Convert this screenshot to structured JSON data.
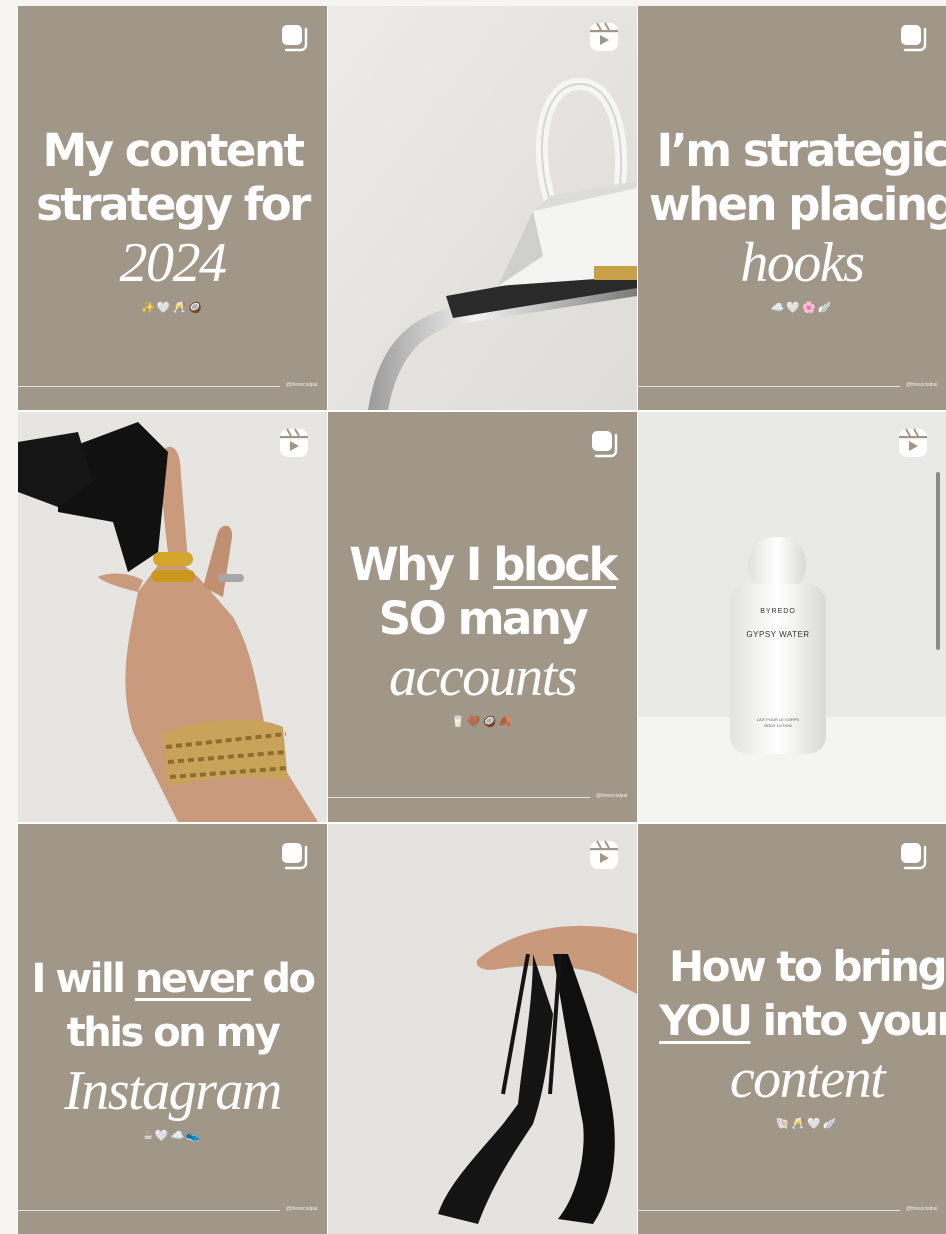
{
  "profile_handle": "@thesocialpal",
  "colors": {
    "tile_background": "#a09788",
    "text": "#ffffff"
  },
  "icons": {
    "carousel": "carousel-icon",
    "reel": "reel-icon"
  },
  "posts": [
    {
      "type": "carousel",
      "line1": "My content",
      "line2": "strategy for",
      "script": "2024",
      "emoji": "✨🤍🥂🥥"
    },
    {
      "type": "reel",
      "photo": "white-handbag-on-chrome-rail"
    },
    {
      "type": "carousel",
      "line1": "I’m strategic",
      "line2": "when placing",
      "script": "hooks",
      "emoji": "☁️🤍🌸🪽"
    },
    {
      "type": "reel",
      "photo": "hand-with-gold-rings-and-sunglasses"
    },
    {
      "type": "carousel",
      "line1a": "Why I ",
      "line1b": "block",
      "line2": "SO many",
      "script": "accounts",
      "emoji": "🥛🤎🥥🍂"
    },
    {
      "type": "reel",
      "photo": "byredo-bottle",
      "bottle_brand": "BYREDO",
      "bottle_name": "GYPSY WATER",
      "bottle_desc": "LAIT POUR LE CORPS",
      "bottle_desc2": "BODY LOTION"
    },
    {
      "type": "carousel",
      "line1a": "I will ",
      "line1b": "never",
      "line1c": " do",
      "line2": "this on my",
      "script": "Instagram",
      "emoji": "☕🤍☁️👟"
    },
    {
      "type": "reel",
      "photo": "black-strappy-heels"
    },
    {
      "type": "carousel",
      "line1": "How to bring",
      "line2a": "YOU",
      "line2b": " into your",
      "script": "content",
      "emoji": "🐚🥂🤍🪽"
    }
  ]
}
